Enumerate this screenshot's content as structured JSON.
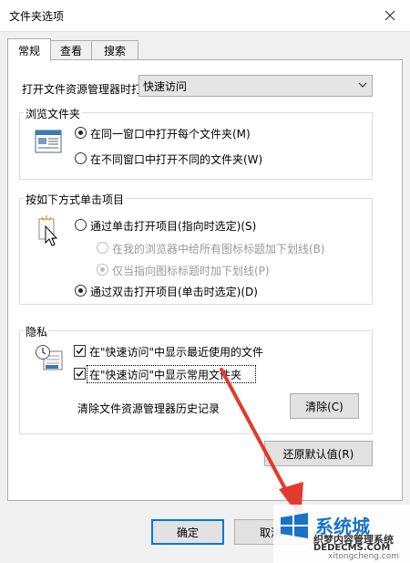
{
  "window": {
    "title": "文件夹选项"
  },
  "tabs": [
    {
      "label": "常规",
      "active": true
    },
    {
      "label": "查看",
      "active": false
    },
    {
      "label": "搜索",
      "active": false
    }
  ],
  "open_explorer": {
    "label": "打开文件资源管理器时打",
    "value": "快速访问"
  },
  "browse_folders": {
    "legend": "浏览文件夹",
    "options": [
      "在同一窗口中打开每个文件夹(M)",
      "在不同窗口中打开不同的文件夹(W)"
    ],
    "selected": 0
  },
  "click_items": {
    "legend": "按如下方式单击项目",
    "single_click": "通过单击打开项目(指向时选定)(S)",
    "underline_all": "在我的浏览器中给所有图标标题加下划线(B)",
    "underline_point": "仅当指向图标标题时加下划线(P)",
    "double_click": "通过双击打开项目(单击时选定)(D)"
  },
  "privacy": {
    "legend": "隐私",
    "show_recent_files": "在\"快速访问\"中显示最近使用的文件",
    "show_frequent_folders": "在\"快速访问\"中显示常用文件夹",
    "clear_history_label": "清除文件资源管理器历史记录",
    "clear_button": "清除(C)"
  },
  "restore_defaults": "还原默认值(R)",
  "footer": {
    "ok": "确定",
    "cancel": "取消"
  },
  "watermark": {
    "brand": "系统城",
    "site_cn": "织梦内容管理系统",
    "site_en": "DEDECMS.COM",
    "url": "xitongcheng.com"
  },
  "colors": {
    "accent": "#0078d7",
    "arrow": "#e23a2c",
    "watermark_blue": "#1a73c9"
  }
}
